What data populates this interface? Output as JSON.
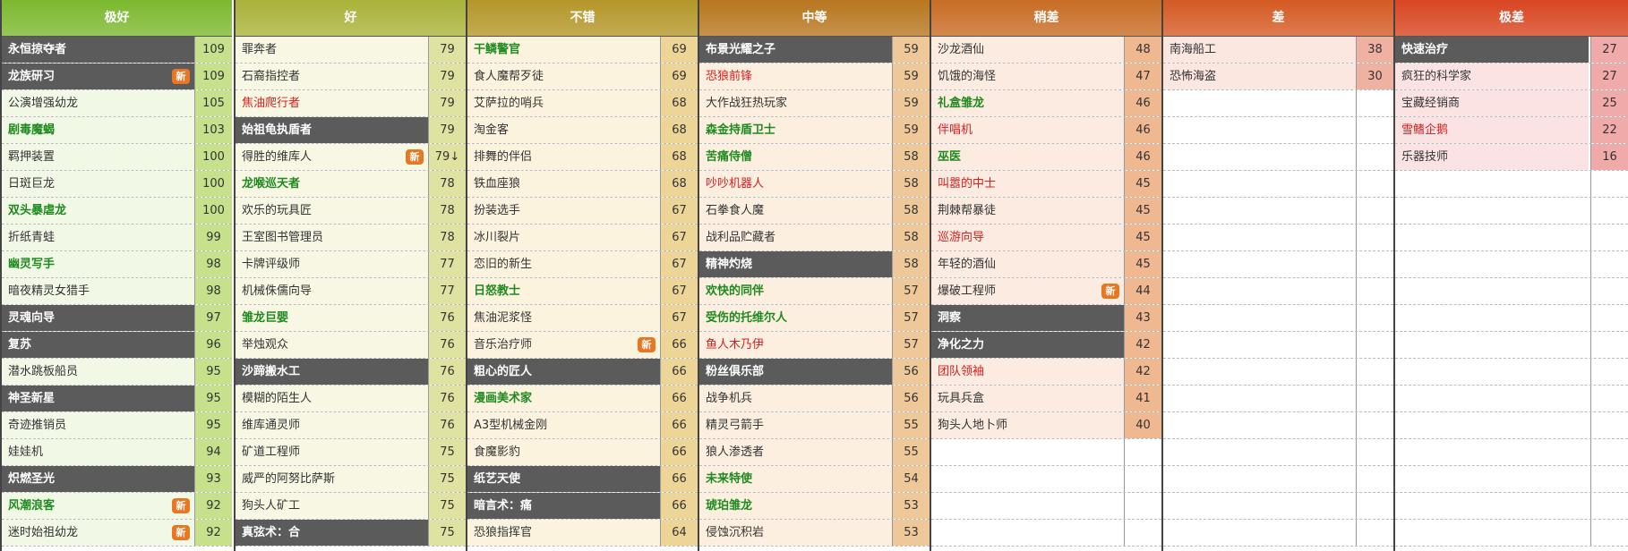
{
  "columns": [
    {
      "title": "极好",
      "header_color": "#7cb82f",
      "row_color": "#f1f8e6",
      "score_color": "#c6e08c",
      "rows": [
        {
          "name": "永恒掠夺者",
          "score": "109",
          "style": "dark"
        },
        {
          "name": "龙族研习",
          "score": "109",
          "style": "dark",
          "badge": "新"
        },
        {
          "name": "公演增强幼龙",
          "score": "105",
          "style": ""
        },
        {
          "name": "剧毒魔蝎",
          "score": "103",
          "style": "green"
        },
        {
          "name": "羁押装置",
          "score": "100",
          "style": ""
        },
        {
          "name": "日斑巨龙",
          "score": "100",
          "style": ""
        },
        {
          "name": "双头暴虐龙",
          "score": "100",
          "style": "green"
        },
        {
          "name": "折纸青蛙",
          "score": "99",
          "style": ""
        },
        {
          "name": "幽灵写手",
          "score": "98",
          "style": "green"
        },
        {
          "name": "暗夜精灵女猎手",
          "score": "98",
          "style": ""
        },
        {
          "name": "灵魂向导",
          "score": "97",
          "style": "dark"
        },
        {
          "name": "复苏",
          "score": "96",
          "style": "dark"
        },
        {
          "name": "潜水跳板船员",
          "score": "95",
          "style": ""
        },
        {
          "name": "神圣新星",
          "score": "95",
          "style": "dark"
        },
        {
          "name": "奇迹推销员",
          "score": "95",
          "style": ""
        },
        {
          "name": "娃娃机",
          "score": "94",
          "style": ""
        },
        {
          "name": "炽燃圣光",
          "score": "93",
          "style": "dark"
        },
        {
          "name": "风潮浪客",
          "score": "92",
          "style": "green",
          "badge": "新"
        },
        {
          "name": "迷时始祖幼龙",
          "score": "92",
          "style": "",
          "badge": "新"
        }
      ]
    },
    {
      "title": "好",
      "header_color": "#a9b23a",
      "row_color": "#f8f7e4",
      "score_color": "#dfe2a0",
      "rows": [
        {
          "name": "罪奔者",
          "score": "79",
          "style": ""
        },
        {
          "name": "石裔指控者",
          "score": "79",
          "style": ""
        },
        {
          "name": "焦油爬行者",
          "score": "79",
          "style": "red"
        },
        {
          "name": "始祖龟执盾者",
          "score": "79",
          "style": "dark"
        },
        {
          "name": "得胜的维库人",
          "score": "79↓",
          "style": "",
          "badge": "新"
        },
        {
          "name": "龙喉巡天者",
          "score": "78",
          "style": "green"
        },
        {
          "name": "欢乐的玩具匠",
          "score": "78",
          "style": ""
        },
        {
          "name": "王室图书管理员",
          "score": "78",
          "style": ""
        },
        {
          "name": "卡牌评级师",
          "score": "77",
          "style": ""
        },
        {
          "name": "机械侏儒向导",
          "score": "77",
          "style": ""
        },
        {
          "name": "雏龙巨婴",
          "score": "76",
          "style": "green"
        },
        {
          "name": "举烛观众",
          "score": "76",
          "style": ""
        },
        {
          "name": "沙蹄搬水工",
          "score": "76",
          "style": "dark"
        },
        {
          "name": "模糊的陌生人",
          "score": "76",
          "style": ""
        },
        {
          "name": "维库通灵师",
          "score": "76",
          "style": ""
        },
        {
          "name": "矿道工程师",
          "score": "75",
          "style": ""
        },
        {
          "name": "威严的阿努比萨斯",
          "score": "75",
          "style": ""
        },
        {
          "name": "狗头人矿工",
          "score": "75",
          "style": ""
        },
        {
          "name": "真弦术：合",
          "score": "75",
          "style": "dark"
        }
      ]
    },
    {
      "title": "不错",
      "header_color": "#b49628",
      "row_color": "#fcf3df",
      "score_color": "#ecd597",
      "rows": [
        {
          "name": "干鳞警官",
          "score": "69",
          "style": "green"
        },
        {
          "name": "食人魔帮歹徒",
          "score": "69",
          "style": ""
        },
        {
          "name": "艾萨拉的哨兵",
          "score": "68",
          "style": ""
        },
        {
          "name": "淘金客",
          "score": "68",
          "style": ""
        },
        {
          "name": "排舞的伴侣",
          "score": "68",
          "style": ""
        },
        {
          "name": "铁血座狼",
          "score": "68",
          "style": ""
        },
        {
          "name": "扮装选手",
          "score": "67",
          "style": ""
        },
        {
          "name": "冰川裂片",
          "score": "67",
          "style": ""
        },
        {
          "name": "恋旧的新生",
          "score": "67",
          "style": ""
        },
        {
          "name": "日怒教士",
          "score": "67",
          "style": "green"
        },
        {
          "name": "焦油泥浆怪",
          "score": "67",
          "style": ""
        },
        {
          "name": "音乐治疗师",
          "score": "66",
          "style": "",
          "badge": "新"
        },
        {
          "name": "粗心的匠人",
          "score": "66",
          "style": "dark"
        },
        {
          "name": "漫画美术家",
          "score": "66",
          "style": "green"
        },
        {
          "name": "A3型机械金刚",
          "score": "66",
          "style": ""
        },
        {
          "name": "食魔影豹",
          "score": "66",
          "style": ""
        },
        {
          "name": "纸艺天使",
          "score": "66",
          "style": "dark"
        },
        {
          "name": "暗言术：痛",
          "score": "66",
          "style": "dark"
        },
        {
          "name": "恐狼指挥官",
          "score": "64",
          "style": ""
        }
      ]
    },
    {
      "title": "中等",
      "header_color": "#b8761f",
      "row_color": "#fcefe0",
      "score_color": "#efc89a",
      "rows": [
        {
          "name": "布景光耀之子",
          "score": "59",
          "style": "dark"
        },
        {
          "name": "恐狼前锋",
          "score": "59",
          "style": "red"
        },
        {
          "name": "大作战狂热玩家",
          "score": "59",
          "style": ""
        },
        {
          "name": "森金持盾卫士",
          "score": "59",
          "style": "green"
        },
        {
          "name": "苦痛侍僧",
          "score": "58",
          "style": "green"
        },
        {
          "name": "吵吵机器人",
          "score": "58",
          "style": "red"
        },
        {
          "name": "石拳食人魔",
          "score": "58",
          "style": ""
        },
        {
          "name": "战利品贮藏者",
          "score": "58",
          "style": ""
        },
        {
          "name": "精神灼烧",
          "score": "58",
          "style": "dark"
        },
        {
          "name": "欢快的同伴",
          "score": "57",
          "style": "green"
        },
        {
          "name": "受伤的托维尔人",
          "score": "57",
          "style": "green"
        },
        {
          "name": "鱼人木乃伊",
          "score": "57",
          "style": "red"
        },
        {
          "name": "粉丝俱乐部",
          "score": "56",
          "style": "dark"
        },
        {
          "name": "战争机兵",
          "score": "56",
          "style": ""
        },
        {
          "name": "精灵弓箭手",
          "score": "55",
          "style": ""
        },
        {
          "name": "狼人渗透者",
          "score": "55",
          "style": ""
        },
        {
          "name": "未来特使",
          "score": "54",
          "style": "green"
        },
        {
          "name": "琥珀雏龙",
          "score": "53",
          "style": "green"
        },
        {
          "name": "侵蚀沉积岩",
          "score": "53",
          "style": ""
        }
      ]
    },
    {
      "title": "稍差",
      "header_color": "#c86c24",
      "row_color": "#fcebe0",
      "score_color": "#efb891",
      "rows": [
        {
          "name": "沙龙酒仙",
          "score": "48",
          "style": ""
        },
        {
          "name": "饥饿的海怪",
          "score": "47",
          "style": ""
        },
        {
          "name": "礼盒雏龙",
          "score": "46",
          "style": "green"
        },
        {
          "name": "伴唱机",
          "score": "46",
          "style": "red"
        },
        {
          "name": "巫医",
          "score": "46",
          "style": "green"
        },
        {
          "name": "叫嚣的中士",
          "score": "45",
          "style": "red"
        },
        {
          "name": "荆棘帮暴徒",
          "score": "45",
          "style": ""
        },
        {
          "name": "巡游向导",
          "score": "45",
          "style": "red"
        },
        {
          "name": "年轻的酒仙",
          "score": "45",
          "style": ""
        },
        {
          "name": "爆破工程师",
          "score": "44",
          "style": "",
          "badge": "新"
        },
        {
          "name": "洞察",
          "score": "43",
          "style": "dark"
        },
        {
          "name": "净化之力",
          "score": "42",
          "style": "dark"
        },
        {
          "name": "团队领袖",
          "score": "42",
          "style": "red"
        },
        {
          "name": "玩具兵盒",
          "score": "41",
          "style": ""
        },
        {
          "name": "狗头人地卜师",
          "score": "40",
          "style": ""
        }
      ]
    },
    {
      "title": "差",
      "header_color": "#d55a23",
      "row_color": "#fce6e0",
      "score_color": "#efb1a2",
      "rows": [
        {
          "name": "南海船工",
          "score": "38",
          "style": ""
        },
        {
          "name": "恐怖海盗",
          "score": "30",
          "style": ""
        }
      ]
    },
    {
      "title": "极差",
      "header_color": "#d84520",
      "row_color": "#fce3e3",
      "score_color": "#f0aaaa",
      "rows": [
        {
          "name": "快速治疗",
          "score": "27",
          "style": "dark"
        },
        {
          "name": "疯狂的科学家",
          "score": "27",
          "style": ""
        },
        {
          "name": "宝藏经销商",
          "score": "25",
          "style": ""
        },
        {
          "name": "雪鳍企鹅",
          "score": "22",
          "style": "red"
        },
        {
          "name": "乐器技师",
          "score": "16",
          "style": ""
        }
      ]
    }
  ]
}
